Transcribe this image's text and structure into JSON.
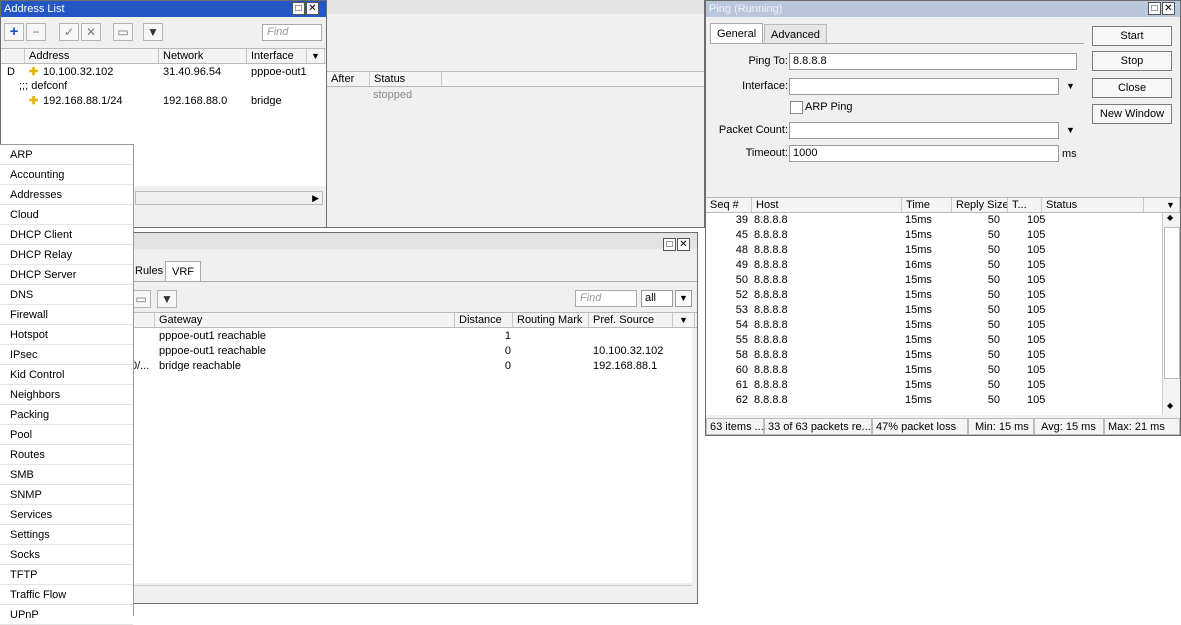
{
  "address_list": {
    "title": "Address List",
    "find_placeholder": "Find",
    "columns": [
      "Address",
      "Network",
      "Interface"
    ],
    "rows": [
      {
        "flag": "D",
        "address": "10.100.32.102",
        "network": "31.40.96.54",
        "interface": "pppoe-out1"
      },
      {
        "flag": "",
        "comment": ";;; defconf"
      },
      {
        "flag": "",
        "address": "192.168.88.1/24",
        "network": "192.168.88.0",
        "interface": "bridge"
      }
    ]
  },
  "bg_window": {
    "columns": [
      "After",
      "Status"
    ],
    "status_value": "stopped"
  },
  "routes_window": {
    "tabs": [
      "Rules",
      "VRF"
    ],
    "find_placeholder": "Find",
    "filter_value": "all",
    "columns": [
      "Gateway",
      "Distance",
      "Routing Mark",
      "Pref. Source"
    ],
    "rows": [
      {
        "prefix": "",
        "gateway": "pppoe-out1 reachable",
        "distance": "1",
        "routing_mark": "",
        "pref_source": ""
      },
      {
        "prefix": "",
        "gateway": "pppoe-out1 reachable",
        "distance": "0",
        "routing_mark": "",
        "pref_source": "10.100.32.102"
      },
      {
        "prefix": "0/...",
        "gateway": "bridge reachable",
        "distance": "0",
        "routing_mark": "",
        "pref_source": "192.168.88.1"
      }
    ]
  },
  "ping": {
    "title": "Ping (Running)",
    "tabs": [
      "General",
      "Advanced"
    ],
    "labels": {
      "ping_to": "Ping To:",
      "interface": "Interface:",
      "arp_ping": "ARP Ping",
      "packet_count": "Packet Count:",
      "timeout": "Timeout:",
      "timeout_unit": "ms"
    },
    "values": {
      "ping_to": "8.8.8.8",
      "interface": "",
      "packet_count": "",
      "timeout": "1000"
    },
    "buttons": [
      "Start",
      "Stop",
      "Close",
      "New Window"
    ],
    "columns": [
      "Seq #",
      "Host",
      "Time",
      "Reply Size",
      "T...",
      "Status"
    ],
    "rows": [
      {
        "seq": "39",
        "host": "8.8.8.8",
        "time": "15ms",
        "size": "50",
        "ttl": "105"
      },
      {
        "seq": "45",
        "host": "8.8.8.8",
        "time": "15ms",
        "size": "50",
        "ttl": "105"
      },
      {
        "seq": "48",
        "host": "8.8.8.8",
        "time": "15ms",
        "size": "50",
        "ttl": "105"
      },
      {
        "seq": "49",
        "host": "8.8.8.8",
        "time": "16ms",
        "size": "50",
        "ttl": "105"
      },
      {
        "seq": "50",
        "host": "8.8.8.8",
        "time": "15ms",
        "size": "50",
        "ttl": "105"
      },
      {
        "seq": "52",
        "host": "8.8.8.8",
        "time": "15ms",
        "size": "50",
        "ttl": "105"
      },
      {
        "seq": "53",
        "host": "8.8.8.8",
        "time": "15ms",
        "size": "50",
        "ttl": "105"
      },
      {
        "seq": "54",
        "host": "8.8.8.8",
        "time": "15ms",
        "size": "50",
        "ttl": "105"
      },
      {
        "seq": "55",
        "host": "8.8.8.8",
        "time": "15ms",
        "size": "50",
        "ttl": "105"
      },
      {
        "seq": "58",
        "host": "8.8.8.8",
        "time": "15ms",
        "size": "50",
        "ttl": "105"
      },
      {
        "seq": "60",
        "host": "8.8.8.8",
        "time": "15ms",
        "size": "50",
        "ttl": "105"
      },
      {
        "seq": "61",
        "host": "8.8.8.8",
        "time": "15ms",
        "size": "50",
        "ttl": "105"
      },
      {
        "seq": "62",
        "host": "8.8.8.8",
        "time": "15ms",
        "size": "50",
        "ttl": "105"
      }
    ],
    "status_bar": {
      "items": "63 items ...",
      "packets": "33 of 63 packets re...",
      "loss": "47% packet loss",
      "min": "Min: 15 ms",
      "avg": "Avg: 15 ms",
      "max": "Max: 21 ms"
    }
  },
  "ip_menu": {
    "items": [
      "ARP",
      "Accounting",
      "Addresses",
      "Cloud",
      "DHCP Client",
      "DHCP Relay",
      "DHCP Server",
      "DNS",
      "Firewall",
      "Hotspot",
      "IPsec",
      "Kid Control",
      "Neighbors",
      "Packing",
      "Pool",
      "Routes",
      "SMB",
      "SNMP",
      "Services",
      "Settings",
      "Socks",
      "TFTP",
      "Traffic Flow",
      "UPnP"
    ]
  },
  "colors": {
    "title_active": "#2456c4",
    "title_inactive": "#b9c6dc",
    "icon_yellow": "#e0b400",
    "add_blue": "#1d4fc0"
  }
}
